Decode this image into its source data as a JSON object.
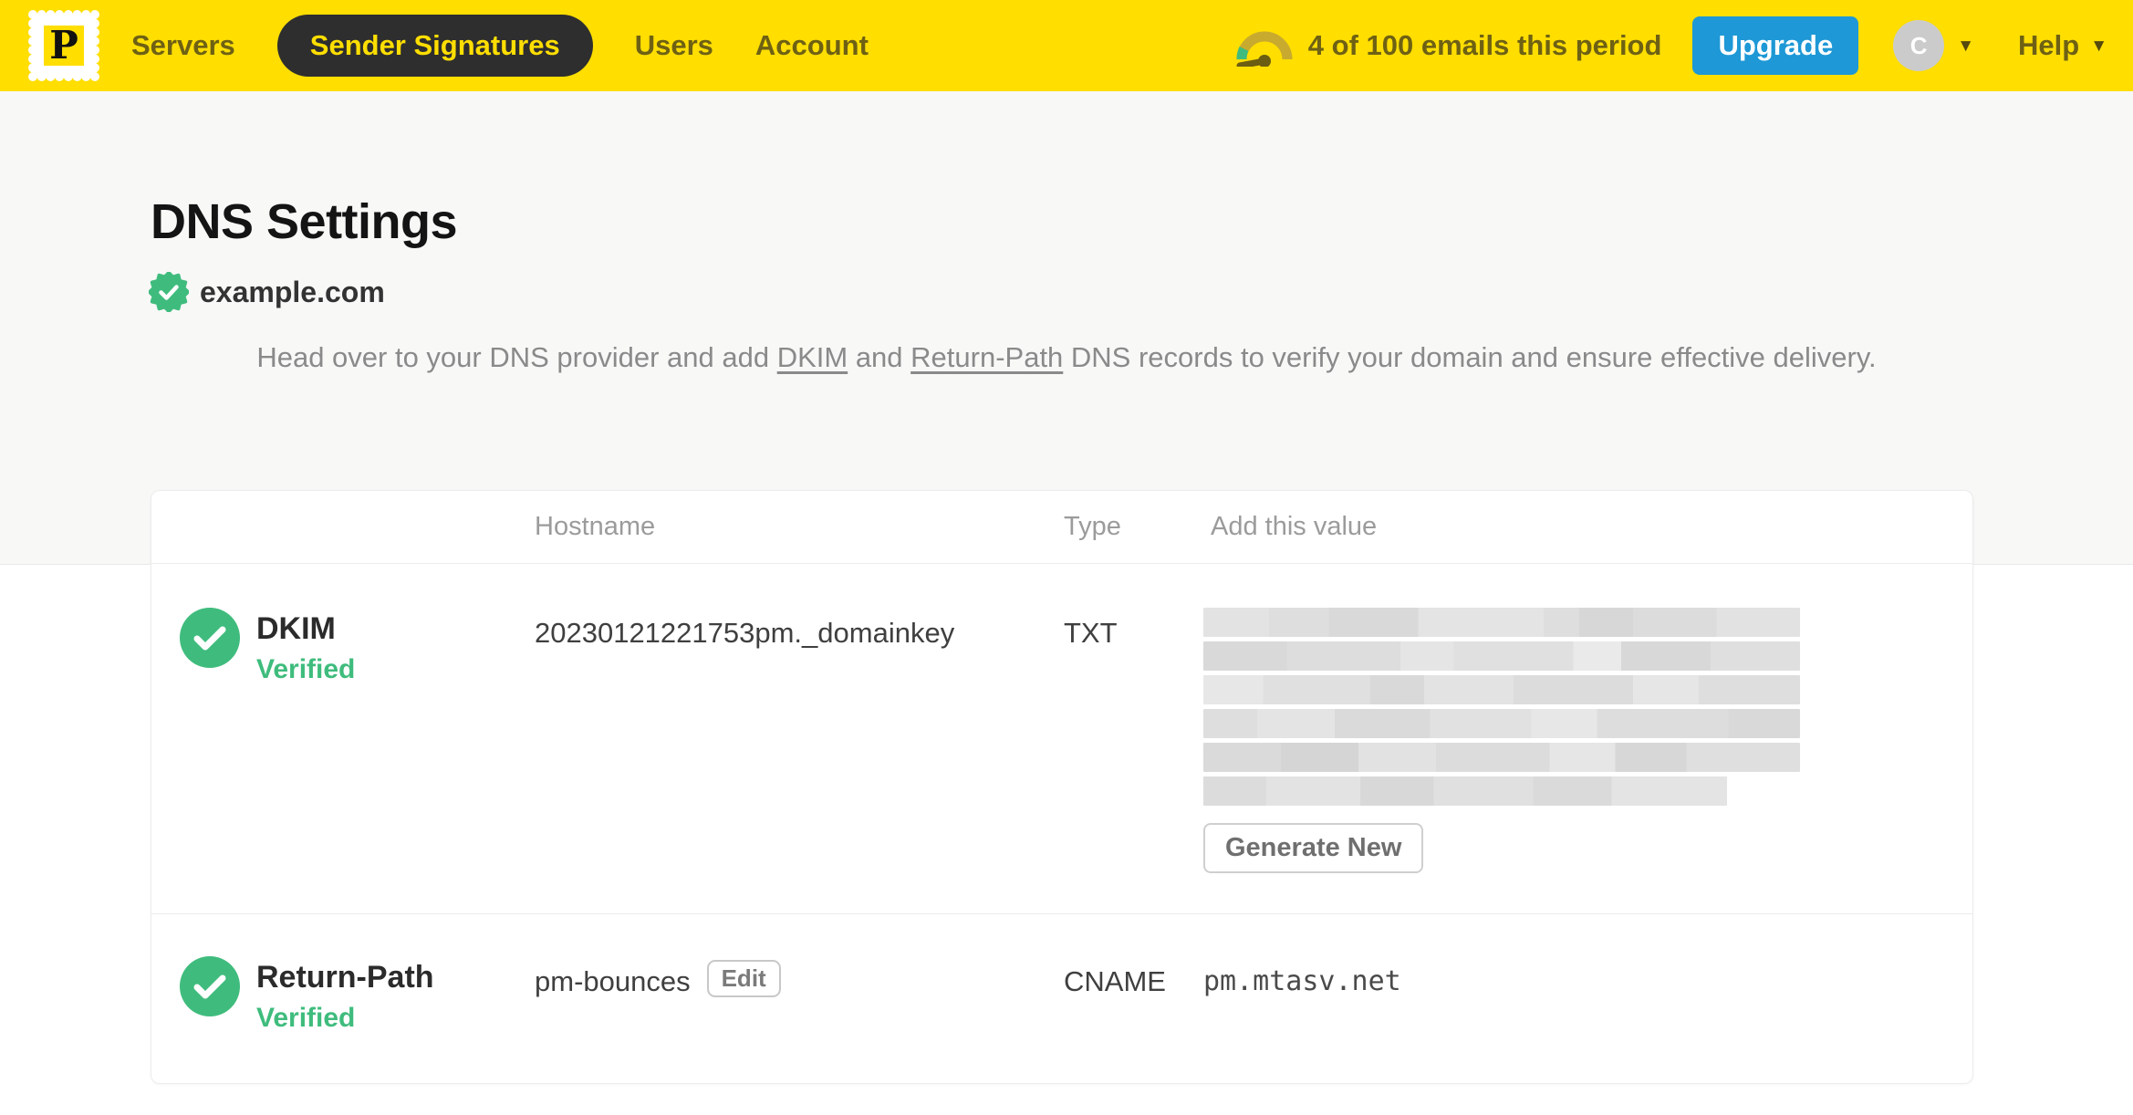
{
  "nav": {
    "logo_letter": "P",
    "items": [
      {
        "label": "Servers",
        "active": false
      },
      {
        "label": "Sender Signatures",
        "active": true
      },
      {
        "label": "Users",
        "active": false
      },
      {
        "label": "Account",
        "active": false
      }
    ],
    "usage_text": "4 of 100 emails this period",
    "upgrade_label": "Upgrade",
    "avatar_initial": "C",
    "help_label": "Help"
  },
  "page": {
    "title": "DNS Settings",
    "domain": "example.com",
    "desc": {
      "p1": "Head over to your DNS provider and add ",
      "link_dkim": "DKIM",
      "p2": " and ",
      "link_return_path": "Return-Path",
      "p3": " DNS records to verify your domain and ensure effective delivery."
    }
  },
  "table": {
    "headers": {
      "hostname": "Hostname",
      "type": "Type",
      "value": "Add this value"
    },
    "rows": [
      {
        "name": "DKIM",
        "status": "Verified",
        "hostname": "20230121221753pm._domainkey",
        "type": "TXT",
        "value_redacted": true,
        "action": "Generate New"
      },
      {
        "name": "Return-Path",
        "status": "Verified",
        "hostname": "pm-bounces",
        "edit_label": "Edit",
        "type": "CNAME",
        "value": "pm.mtasv.net"
      }
    ]
  },
  "colors": {
    "brand_yellow": "#FFDE00",
    "nav_pill_bg": "#2e2e2e",
    "upgrade_blue": "#1e98d6",
    "verified_green": "#3fbc7d"
  }
}
